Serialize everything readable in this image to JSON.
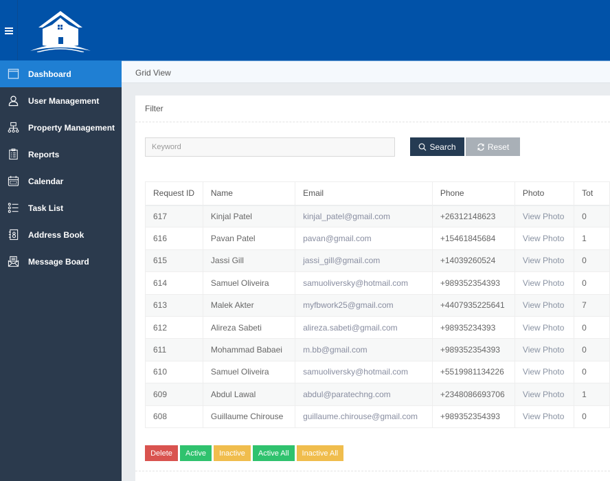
{
  "header": {
    "menu_icon": "hamburger-icon",
    "logo_icon": "house-logo-icon"
  },
  "sidebar": {
    "items": [
      {
        "label": "Dashboard",
        "icon": "window-icon",
        "active": true
      },
      {
        "label": "User Management",
        "icon": "user-icon",
        "active": false
      },
      {
        "label": "Property Management",
        "icon": "sitemap-icon",
        "active": false
      },
      {
        "label": "Reports",
        "icon": "clipboard-icon",
        "active": false
      },
      {
        "label": "Calendar",
        "icon": "calendar-icon",
        "active": false
      },
      {
        "label": "Task List",
        "icon": "list-icon",
        "active": false
      },
      {
        "label": "Address Book",
        "icon": "address-book-icon",
        "active": false
      },
      {
        "label": "Message Board",
        "icon": "message-board-icon",
        "active": false
      }
    ]
  },
  "breadcrumb": {
    "title": "Grid View"
  },
  "filter": {
    "title": "Filter",
    "keyword_placeholder": "Keyword",
    "keyword_value": "",
    "search_label": "Search",
    "reset_label": "Reset"
  },
  "table": {
    "columns": [
      "Request ID",
      "Name",
      "Email",
      "Phone",
      "Photo",
      "Tot"
    ],
    "rows": [
      {
        "id": "617",
        "name": "Kinjal Patel",
        "email": "kinjal_patel@gmail.com",
        "phone": "+26312148623",
        "photo": "View Photo",
        "total": "0"
      },
      {
        "id": "616",
        "name": "Pavan Patel",
        "email": "pavan@gmail.com",
        "phone": "+15461845684",
        "photo": "View Photo",
        "total": "1"
      },
      {
        "id": "615",
        "name": "Jassi Gill",
        "email": "jassi_gill@gmail.com",
        "phone": "+14039260524",
        "photo": "View Photo",
        "total": "0"
      },
      {
        "id": "614",
        "name": "Samuel Oliveira",
        "email": "samuoliversky@hotmail.com",
        "phone": "+989352354393",
        "photo": "View Photo",
        "total": "0"
      },
      {
        "id": "613",
        "name": "Malek Akter",
        "email": "myfbwork25@gmail.com",
        "phone": "+4407935225641",
        "photo": "View Photo",
        "total": "7"
      },
      {
        "id": "612",
        "name": "Alireza Sabeti",
        "email": "alireza.sabeti@gmail.com",
        "phone": "+98935234393",
        "photo": "View Photo",
        "total": "0"
      },
      {
        "id": "611",
        "name": "Mohammad Babaei",
        "email": "m.bb@gmail.com",
        "phone": "+989352354393",
        "photo": "View Photo",
        "total": "0"
      },
      {
        "id": "610",
        "name": "Samuel Oliveira",
        "email": "samuoliversky@hotmail.com",
        "phone": "+5519981134226",
        "photo": "View Photo",
        "total": "0"
      },
      {
        "id": "609",
        "name": "Abdul Lawal",
        "email": "abdul@paratechng.com",
        "phone": "+2348086693706",
        "photo": "View Photo",
        "total": "1"
      },
      {
        "id": "608",
        "name": "Guillaume Chirouse",
        "email": "guillaume.chirouse@gmail.com",
        "phone": "+989352354393",
        "photo": "View Photo",
        "total": "0"
      }
    ]
  },
  "actions": {
    "delete": "Delete",
    "active": "Active",
    "inactive": "Inactive",
    "active_all": "Active All",
    "inactive_all": "Inactive All"
  },
  "colors": {
    "header_blue": "#0152a8",
    "sidebar_bg": "#2b3a4d",
    "active_item": "#1f7fd3",
    "search_btn": "#253b53",
    "reset_btn": "#a9b0b7",
    "danger": "#d9534f",
    "success": "#2fc26e",
    "warning": "#f0bd4d"
  }
}
